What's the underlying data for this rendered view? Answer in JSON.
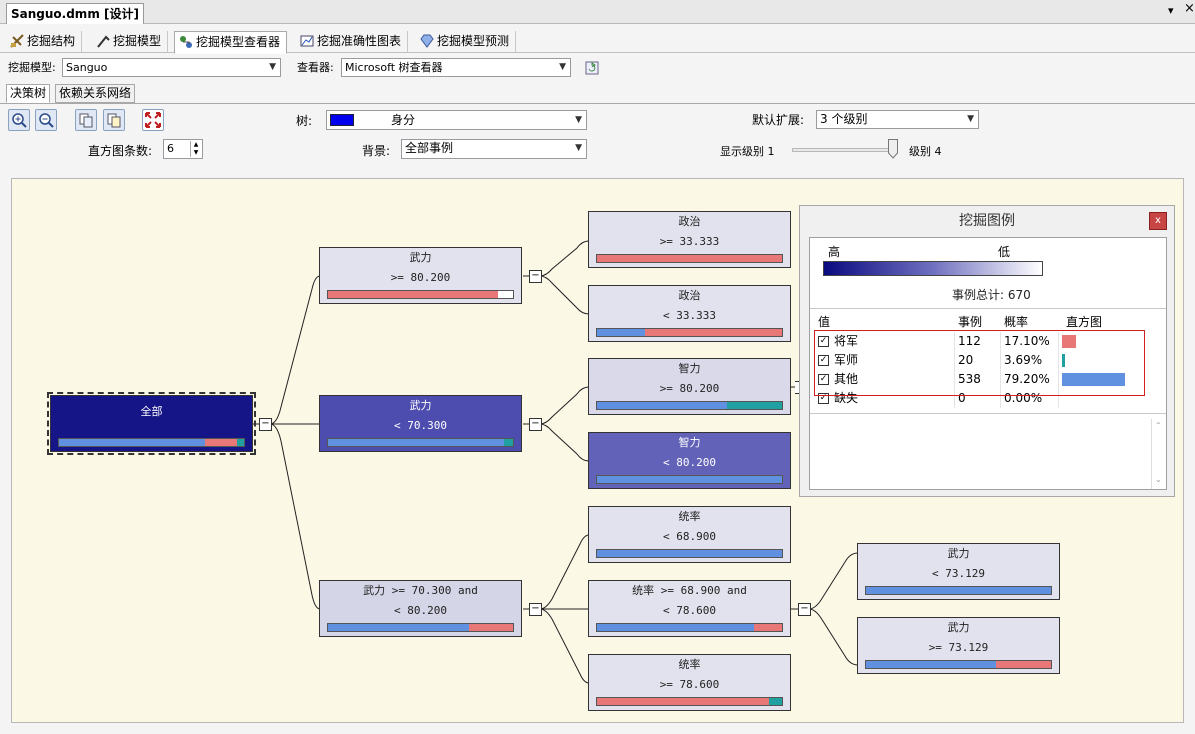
{
  "doc_tab": {
    "title": "Sanguo.dmm [设计]",
    "dropdown_glyph": "▾",
    "close_glyph": "×"
  },
  "designer_tabs": [
    {
      "label": "挖掘结构",
      "icon": "mining-structure-icon"
    },
    {
      "label": "挖掘模型",
      "icon": "mining-model-icon"
    },
    {
      "label": "挖掘模型查看器",
      "icon": "model-viewer-icon"
    },
    {
      "label": "挖掘准确性图表",
      "icon": "accuracy-chart-icon"
    },
    {
      "label": "挖掘模型预测",
      "icon": "prediction-icon"
    }
  ],
  "model_bar": {
    "model_label": "挖掘模型:",
    "model_value": "Sanguo",
    "viewer_label": "查看器:",
    "viewer_value": "Microsoft 树查看器"
  },
  "sub_tabs": [
    "决策树",
    "依赖关系网络"
  ],
  "controls": {
    "tree_label": "树:",
    "tree_value": "身分",
    "tree_swatch": "#0000ee",
    "default_expand_label": "默认扩展:",
    "default_expand_value": "3 个级别",
    "histogram_label": "直方图条数:",
    "histogram_value": "6",
    "background_label": "背景:",
    "background_value": "全部事例",
    "show_level_label": "显示级别 1",
    "level_label": "级别 4",
    "level_current": 4,
    "level_max": 4
  },
  "colors": {
    "jiangjun": "#e87878",
    "junshi": "#20a0a0",
    "other": "#6090e0"
  },
  "tree": {
    "root": {
      "l1": "全部",
      "l2": "",
      "bar": [
        0.791,
        0.171,
        0.037
      ],
      "bg": "#151587"
    },
    "n_wuli_ge80": {
      "l1": "武力",
      "l2": ">= 80.200",
      "bar": [
        0.0,
        0.92,
        0.0
      ],
      "bg": "#e2e2ee"
    },
    "n_wuli_lt70": {
      "l1": "武力",
      "l2": "< 70.300",
      "bar": [
        0.95,
        0.0,
        0.05
      ],
      "bg": "#4d4db0"
    },
    "n_wuli_mid": {
      "l1": "武力 >= 70.300 and",
      "l2": "< 80.200",
      "bar": [
        0.76,
        0.24,
        0.0
      ],
      "bg": "#d5d5e8"
    },
    "n_zhengzhi_ge": {
      "l1": "政治",
      "l2": ">= 33.333",
      "bar": [
        0.0,
        1.0,
        0.0
      ],
      "bg": "#e2e2ee"
    },
    "n_zhengzhi_lt": {
      "l1": "政治",
      "l2": "< 33.333",
      "bar": [
        0.26,
        0.74,
        0.0
      ],
      "bg": "#e2e2ee"
    },
    "n_zhili_ge": {
      "l1": "智力",
      "l2": ">= 80.200",
      "bar": [
        0.7,
        0.0,
        0.3
      ],
      "bg": "#d9d9ea"
    },
    "n_zhili_lt": {
      "l1": "智力",
      "l2": "< 80.200",
      "bar": [
        1.0,
        0.0,
        0.0
      ],
      "bg": "#6262b8"
    },
    "n_tongshuai_lt": {
      "l1": "统率",
      "l2": "< 68.900",
      "bar": [
        1.0,
        0.0,
        0.0
      ],
      "bg": "#e2e2ee"
    },
    "n_tongshuai_mid": {
      "l1": "统率 >= 68.900 and",
      "l2": "< 78.600",
      "bar": [
        0.85,
        0.15,
        0.0
      ],
      "bg": "#e2e2ee"
    },
    "n_tongshuai_ge": {
      "l1": "统率",
      "l2": ">= 78.600",
      "bar": [
        0.0,
        0.93,
        0.07
      ],
      "bg": "#e2e2ee"
    },
    "n_wuli_lt73": {
      "l1": "武力",
      "l2": "< 73.129",
      "bar": [
        1.0,
        0.0,
        0.0
      ],
      "bg": "#e2e2ee"
    },
    "n_wuli_ge73": {
      "l1": "武力",
      "l2": ">= 73.129",
      "bar": [
        0.7,
        0.3,
        0.0
      ],
      "bg": "#e2e2ee"
    }
  },
  "legend": {
    "title": "挖掘图例",
    "close": "x",
    "high": "高",
    "low": "低",
    "total": "事例总计: 670",
    "headers": [
      "值",
      "事例",
      "概率",
      "直方图"
    ],
    "rows": [
      {
        "name": "将军",
        "count": "112",
        "prob": "17.10%",
        "fraction": 0.171,
        "color": "#e87878"
      },
      {
        "name": "军师",
        "count": "20",
        "prob": "3.69%",
        "fraction": 0.037,
        "color": "#20a0a0"
      },
      {
        "name": "其他",
        "count": "538",
        "prob": "79.20%",
        "fraction": 0.792,
        "color": "#6090e0"
      },
      {
        "name": "缺失",
        "count": "0",
        "prob": "0.00%",
        "fraction": 0.0,
        "color": "#cccccc"
      }
    ]
  }
}
